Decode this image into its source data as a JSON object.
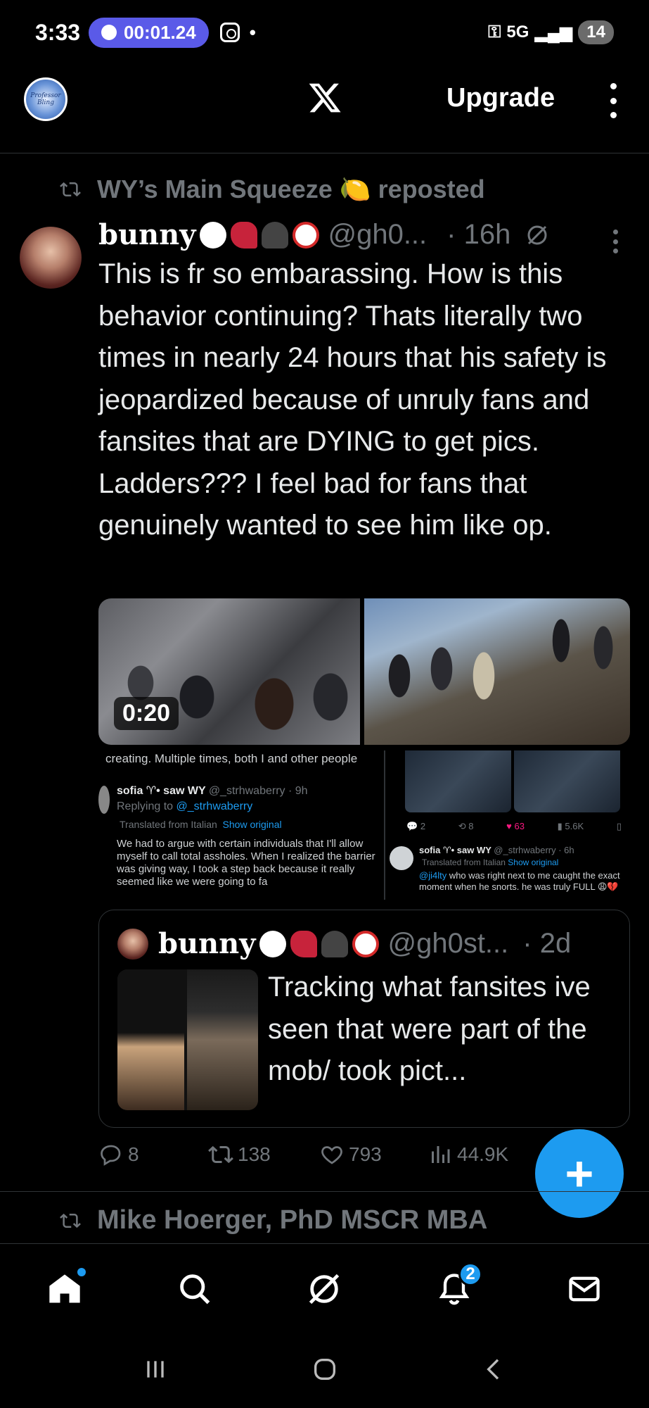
{
  "status_bar": {
    "time": "3:33",
    "timer": "00:01.24",
    "network": "5G",
    "battery": "14"
  },
  "header": {
    "avatar_text": "Professor Bling",
    "upgrade_label": "Upgrade"
  },
  "post": {
    "repost_label": "WY’s Main Squeeze 🍋 reposted",
    "author_name": "bunny",
    "author_handle": "@gh0...",
    "time": "· 16h",
    "text": "This is fr so embarassing. How is this behavior continuing? Thats literally two times in nearly 24 hours that his safety is jeopardized because of unruly fans and fansites that are DYING to get pics. Ladders??? I feel bad for fans that genuinely wanted to see him like op.",
    "video_duration": "0:20",
    "screenshot": {
      "cut_line": "creating. Multiple times, both I and other people",
      "reply_name": "sofia ♈︎• saw WY",
      "reply_handle": "@_strhwaberry · 9h",
      "replying_to": "Replying to",
      "replying_handle": "@_strhwaberry",
      "translated": "Translated from Italian",
      "show_original": "Show original",
      "reply_body": "We had to argue with certain individuals that I'll allow myself to call total assholes. When I realized the barrier was giving way, I took a step back because it really seemed like we were going to fa",
      "stat_replies": "2",
      "stat_reposts": "8",
      "stat_likes": "63",
      "stat_views": "5.6K",
      "q_name": "sofia ♈︎• saw WY",
      "q_handle": "@_strhwaberry · 6h",
      "q_translated": "Translated from Italian",
      "q_show_original": "Show original",
      "q_mention": "@ji4lty",
      "q_body": " who was right next to me caught the exact moment when he snorts. he was truly FULL 😩💔"
    },
    "quote": {
      "author_name": "bunny",
      "author_handle": "@gh0st...",
      "time": "· 2d",
      "text": "Tracking what fansites ive seen that were part of the mob/ took pict..."
    },
    "stats": {
      "replies": "8",
      "reposts": "138",
      "likes": "793",
      "views": "44.9K"
    }
  },
  "next_post": {
    "repost_label": "Mike Hoerger, PhD MSCR MBA"
  },
  "bottom_nav": {
    "notifications_badge": "2"
  },
  "colors": {
    "accent": "#1d9bf0",
    "timer_pill": "#5a5ae8",
    "muted": "#71767b",
    "like_pink": "#f91880"
  }
}
